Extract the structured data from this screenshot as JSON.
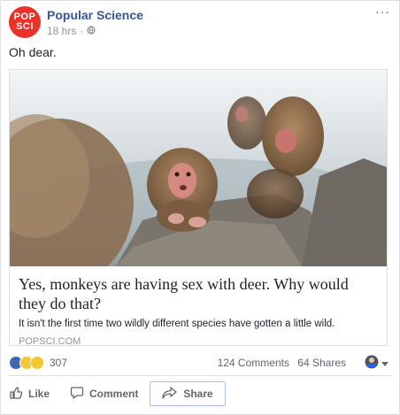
{
  "post": {
    "page_name": "Popular Science",
    "avatar_text": "POP SCI",
    "avatar_line1": "POP",
    "avatar_line2": "SCI",
    "timestamp": "18 hrs",
    "separator": "·",
    "audience_icon": "globe-icon",
    "more_icon": "more-icon",
    "more_glyph": "···",
    "text": "Oh dear."
  },
  "link": {
    "title": "Yes, monkeys are having sex with deer. Why would they do that?",
    "description": "It isn't the first time two wildly different species have gotten a little wild.",
    "domain": "POPSCI.COM"
  },
  "reactions": {
    "icons": [
      "like-reaction-icon",
      "haha-reaction-icon",
      "wow-reaction-icon"
    ],
    "count": "307",
    "comments": "124 Comments",
    "shares": "64 Shares"
  },
  "actions": {
    "like_label": "Like",
    "comment_label": "Comment",
    "share_label": "Share"
  },
  "colors": {
    "brand_link": "#365899",
    "avatar_red": "#e8322a",
    "muted": "#90949c",
    "like_blue": "#4267b2",
    "reaction_yellow": "#f7c736"
  }
}
